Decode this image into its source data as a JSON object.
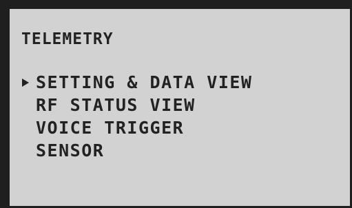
{
  "screen": {
    "title": "TELEMETRY",
    "menu": [
      {
        "label": "SETTING & DATA VIEW",
        "selected": true
      },
      {
        "label": "RF STATUS VIEW",
        "selected": false
      },
      {
        "label": "VOICE TRIGGER",
        "selected": false
      },
      {
        "label": "SENSOR",
        "selected": false
      }
    ],
    "cursor_icon": "triangle-right-icon",
    "colors": {
      "frame": "#1f1f1f",
      "background": "#d2d2d2",
      "text": "#222222"
    }
  }
}
